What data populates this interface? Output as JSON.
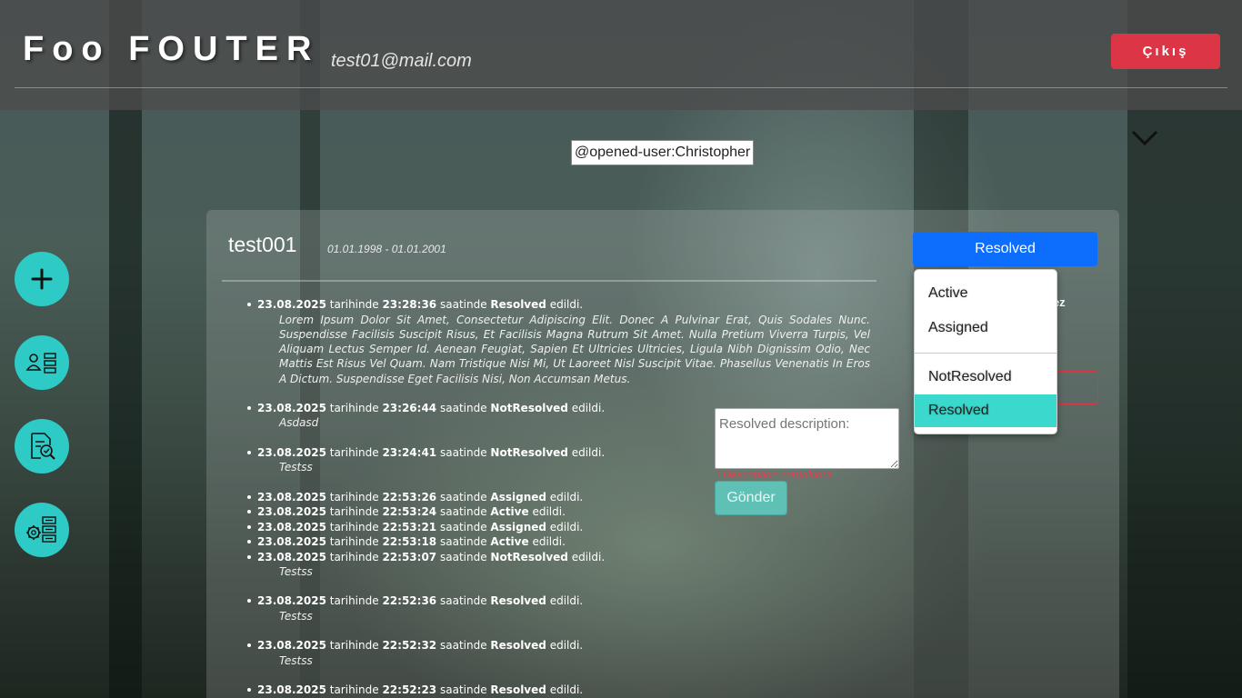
{
  "header": {
    "brand": "Foo FOUTER",
    "email": "test01@mail.com",
    "logout_label": "Çıkış"
  },
  "opened_user_tag": "@opened-user:Christopher",
  "sidebar": {
    "items": [
      {
        "name": "add",
        "icon": "plus-icon"
      },
      {
        "name": "user-assign",
        "icon": "user-list-icon"
      },
      {
        "name": "report-search",
        "icon": "document-search-icon"
      },
      {
        "name": "settings-list",
        "icon": "gear-list-icon"
      }
    ]
  },
  "ticket": {
    "title": "test001",
    "dates": "01.01.1998 - 01.01.2001"
  },
  "history": [
    {
      "date": "23.08.2025",
      "w1": "tarihinde",
      "time": "23:28:36",
      "w2": "saatinde",
      "status": "Resolved",
      "w3": "edildi.",
      "desc": "Lorem Ipsum Dolor Sit Amet, Consectetur Adipiscing Elit. Donec A Pulvinar Erat, Quis Sodales Nunc. Suspendisse Facilisis Suscipit Risus, Et Facilisis Magna Rutrum Sit Amet. Nulla Pretium Viverra Turpis, Vel Aliquam Lectus Semper Id. Aenean Feugiat, Sapien Et Ultricies Ultricies, Ligula Nibh Dignissim Odio, Nec Mattis Est Risus Vel Quam. Nam Tristique Nisi Mi, Ut Laoreet Nisl Suscipit Vitae. Phasellus Venenatis In Eros A Dictum. Suspendisse Eget Facilisis Nisi, Non Accumsan Metus."
    },
    {
      "date": "23.08.2025",
      "w1": "tarihinde",
      "time": "23:26:44",
      "w2": "saatinde",
      "status": "NotResolved",
      "w3": "edildi.",
      "desc": "Asdasd"
    },
    {
      "date": "23.08.2025",
      "w1": "tarihinde",
      "time": "23:24:41",
      "w2": "saatinde",
      "status": "NotResolved",
      "w3": "edildi.",
      "desc": "Testss"
    },
    {
      "date": "23.08.2025",
      "w1": "tarihinde",
      "time": "22:53:26",
      "w2": "saatinde",
      "status": "Assigned",
      "w3": "edildi.",
      "desc": ""
    },
    {
      "date": "23.08.2025",
      "w1": "tarihinde",
      "time": "22:53:24",
      "w2": "saatinde",
      "status": "Active",
      "w3": "edildi.",
      "desc": ""
    },
    {
      "date": "23.08.2025",
      "w1": "tarihinde",
      "time": "22:53:21",
      "w2": "saatinde",
      "status": "Assigned",
      "w3": "edildi.",
      "desc": ""
    },
    {
      "date": "23.08.2025",
      "w1": "tarihinde",
      "time": "22:53:18",
      "w2": "saatinde",
      "status": "Active",
      "w3": "edildi.",
      "desc": ""
    },
    {
      "date": "23.08.2025",
      "w1": "tarihinde",
      "time": "22:53:07",
      "w2": "saatinde",
      "status": "NotResolved",
      "w3": "edildi.",
      "desc": "Testss"
    },
    {
      "date": "23.08.2025",
      "w1": "tarihinde",
      "time": "22:52:36",
      "w2": "saatinde",
      "status": "Resolved",
      "w3": "edildi.",
      "desc": "Testss"
    },
    {
      "date": "23.08.2025",
      "w1": "tarihinde",
      "time": "22:52:32",
      "w2": "saatinde",
      "status": "Resolved",
      "w3": "edildi.",
      "desc": "Testss"
    },
    {
      "date": "23.08.2025",
      "w1": "tarihinde",
      "time": "22:52:23",
      "w2": "saatinde",
      "status": "Resolved",
      "w3": "edildi.",
      "desc": ""
    }
  ],
  "resolve_form": {
    "placeholder": "Resolved description:",
    "error": "* Description zorunludur.",
    "submit_label": "Gönder"
  },
  "partial_text": "hez",
  "status_select": {
    "value": "Resolved",
    "options": [
      "Active",
      "Assigned",
      "NotResolved",
      "Resolved"
    ],
    "selected": "Resolved"
  },
  "colors": {
    "logout": "#dc3545",
    "select": "#0d6efd",
    "accent": "#2ecac6",
    "option_selected": "#3ad8cd"
  }
}
